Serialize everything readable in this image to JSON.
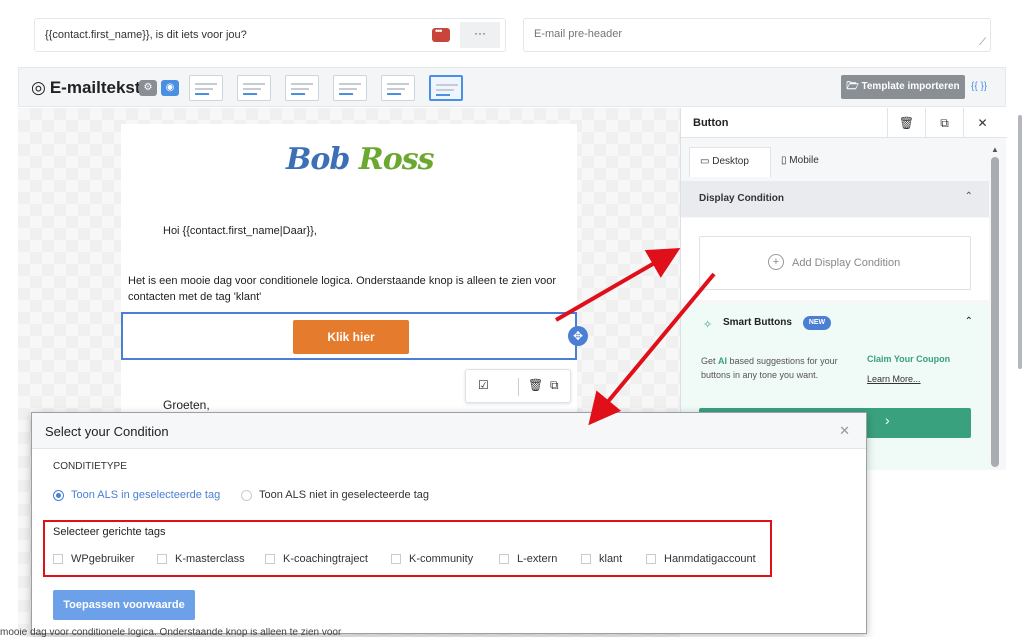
{
  "topbar": {
    "subject": "{{contact.first_name}}, is dit iets voor jou?",
    "more_label": "···",
    "preheader_placeholder": "E-mail pre-header"
  },
  "editor": {
    "title": "E-mailtekst",
    "import_label": "Template importeren",
    "braces_label": "{{ }}"
  },
  "email": {
    "logo_first": "Bob",
    "logo_second": "Ross",
    "greeting": "Hoi {{contact.first_name|Daar}},",
    "paragraph": "Het is een mooie dag voor conditionele logica. Onderstaande knop is alleen te zien voor contacten met de tag 'klant'",
    "button_label": "Klik hier",
    "closing": "Groeten,"
  },
  "panel": {
    "title": "Button",
    "tabs": [
      "Desktop",
      "Mobile"
    ],
    "display_condition": "Display Condition",
    "add_condition": "Add Display Condition",
    "smart_title": "Smart Buttons",
    "smart_badge": "NEW",
    "smart_desc_prefix": "Get ",
    "smart_desc_ai": "AI",
    "smart_desc_rest": " based suggestions for your buttons in any tone you want.",
    "claim": "Claim Your Coupon",
    "learn": "Learn More..."
  },
  "modal": {
    "title": "Select your Condition",
    "condition_type": "CONDITIETYPE",
    "radios": [
      "Toon ALS in geselecteerde tag",
      "Toon ALS niet in geselecteerde tag"
    ],
    "tags_heading": "Selecteer gerichte tags",
    "tags": [
      "WPgebruiker",
      "K-masterclass",
      "K-coachingtraject",
      "K-community",
      "L-extern",
      "klant",
      "Hanmdatigaccount"
    ],
    "apply": "Toepassen voorwaarde"
  },
  "bottom_text": "mooie dag voor conditionele logica. Onderstaande knop is alleen te zien voor",
  "colors": {
    "accent": "#4a7fd4",
    "button_orange": "#e57b2c",
    "annotation_red": "#e0101b",
    "smart_green": "#3aa17e"
  }
}
